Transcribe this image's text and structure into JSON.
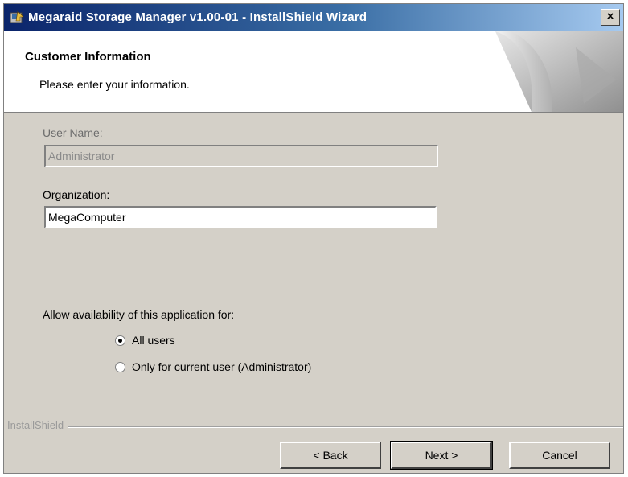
{
  "window": {
    "title": "Megaraid Storage Manager v1.00-01 - InstallShield Wizard",
    "close_label": "×"
  },
  "header": {
    "title": "Customer Information",
    "subtitle": "Please enter your information."
  },
  "form": {
    "user_name_label": "User Name:",
    "user_name_value": "Administrator",
    "organization_label": "Organization:",
    "organization_value": "MegaComputer",
    "availability_label": "Allow availability of this application for:",
    "options": [
      {
        "label": "All users",
        "selected": true
      },
      {
        "label": "Only for current user (Administrator)",
        "selected": false
      }
    ]
  },
  "footer": {
    "brand": "InstallShield"
  },
  "buttons": {
    "back": "< Back",
    "next": "Next >",
    "cancel": "Cancel"
  },
  "colors": {
    "dialog_bg": "#d4d0c8",
    "titlebar_start": "#0a246a",
    "titlebar_end": "#a6caf0"
  }
}
